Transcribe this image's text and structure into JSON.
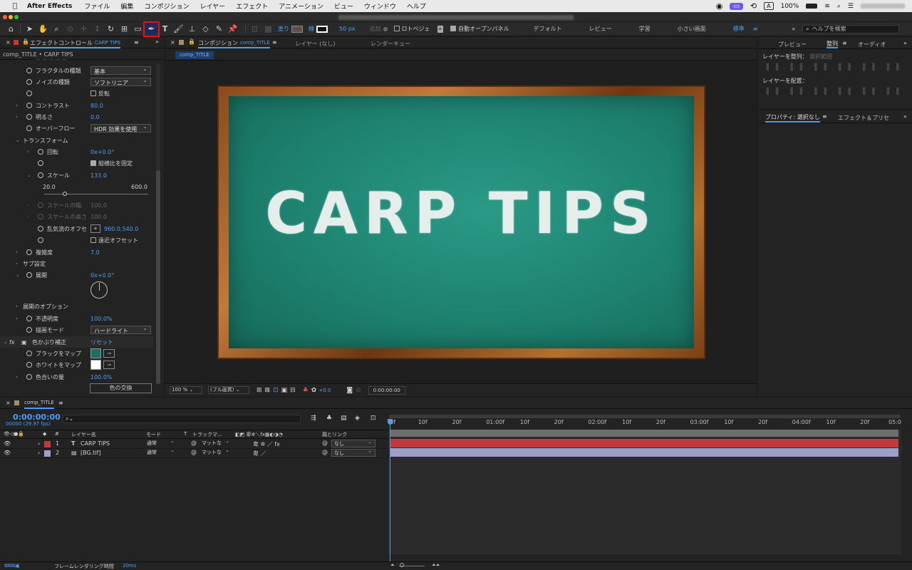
{
  "menubar": {
    "app_name": "After Effects",
    "items": [
      "ファイル",
      "編集",
      "コンポジション",
      "レイヤー",
      "エフェクト",
      "アニメーション",
      "ビュー",
      "ウィンドウ",
      "ヘルプ"
    ],
    "input_indicator": "A",
    "battery": "100%"
  },
  "toolbar": {
    "fill_label": "塗り",
    "stroke_label": "線",
    "stroke_size": "50 px",
    "add_label": "追加",
    "roto_bezier": "ロトベジェ",
    "auto_open": "自動オープンパネル",
    "workspaces": [
      "デフォルト",
      "レビュー",
      "学習",
      "小さい画面",
      "標準"
    ],
    "active_workspace": "標準",
    "search_placeholder": "ヘルプを検索"
  },
  "effect_panel": {
    "tab_label": "エフェクトコントロール",
    "layer_name": "CARP TIPS",
    "breadcrumb": "comp_TITLE • CARP TIPS",
    "rows": {
      "fractal_type_label": "フラクタルの種類",
      "fractal_type_value": "基本",
      "noise_type_label": "ノイズの種類",
      "noise_type_value": "ソフトリニア",
      "invert_label": "反転",
      "contrast_label": "コントラスト",
      "contrast_value": "80.0",
      "brightness_label": "明るさ",
      "brightness_value": "0.0",
      "overflow_label": "オーバーフロー",
      "overflow_value": "HDR 効果を使用",
      "transform_label": "トランスフォーム",
      "rotation_label": "回転",
      "rotation_value": "0x+0.0°",
      "uniform_scale_label": "縦横比を固定",
      "scale_label": "スケール",
      "scale_value": "133.0",
      "scale_min": "20.0",
      "scale_max": "600.0",
      "scale_width_label": "スケールの幅",
      "scale_width_value": "100.0",
      "scale_height_label": "スケールの高さ",
      "scale_height_value": "100.0",
      "offset_label": "乱気流のオフセ",
      "offset_value": "960.0,540.0",
      "perspective_label": "遠近オフセット",
      "complexity_label": "複雑度",
      "complexity_value": "7.0",
      "sub_label": "サブ設定",
      "evolution_label": "展開",
      "evolution_value": "0x+0.0°",
      "evolution_options_label": "展開のオプション",
      "opacity_label": "不透明度",
      "opacity_value": "100.0%",
      "blend_label": "描画モード",
      "blend_value": "ハードライト",
      "tint_label": "色かぶり補正",
      "tint_reset": "リセット",
      "black_label": "ブラックをマップ",
      "white_label": "ホワイトをマップ",
      "amount_label": "色合いの量",
      "amount_value": "100.0%",
      "swap_button": "色の交換"
    },
    "colors": {
      "black_map": "#1d6e5e",
      "white_map": "#ffffff"
    }
  },
  "comp_panel": {
    "tab_label": "コンポジション",
    "comp_name": "comp_TITLE",
    "layer_tab": "レイヤー (なし)",
    "render_tab": "レンダーキュー",
    "flow_tab": "comp_TITLE",
    "canvas_text": "CARP TIPS",
    "zoom": "100 %",
    "quality": "(フル画質)",
    "exposure": "+0.0",
    "timecode": "0:00:00:00"
  },
  "right_panel": {
    "tabs": [
      "プレビュー",
      "整列",
      "オーディオ"
    ],
    "active_tab": "整列",
    "align_to_label": "レイヤーを整列：",
    "align_to_value": "選択範囲",
    "distribute_label": "レイヤーを配置：",
    "props_tab": "プロパティ: 選択なし",
    "effects_tab": "エフェクト＆プリセ"
  },
  "timeline": {
    "comp_name": "comp_TITLE",
    "timecode": "0:00:00:00",
    "fps": "00000 (29.97 fps)",
    "columns": {
      "layer_name": "レイヤー名",
      "mode": "モード",
      "t": "T",
      "track_matte": "トラックマ...",
      "parent": "親とリンク"
    },
    "layers": [
      {
        "num": "1",
        "name": "CARP TIPS",
        "type": "T",
        "mode": "通常",
        "matte": "マットな",
        "parent": "なし",
        "color": "#c0393b"
      },
      {
        "num": "2",
        "name": "[BG.tif]",
        "type": "file",
        "mode": "通常",
        "matte": "マットな",
        "parent": "なし",
        "color": "#9d9fc7"
      }
    ],
    "ruler": [
      "0f",
      "10f",
      "20f",
      "01:00f",
      "10f",
      "20f",
      "02:00f",
      "10f",
      "20f",
      "03:00f",
      "10f",
      "20f",
      "04:00f",
      "10f",
      "20f",
      "05:0"
    ],
    "status": "フレームレンダリング時間",
    "status_value": "20ms"
  }
}
